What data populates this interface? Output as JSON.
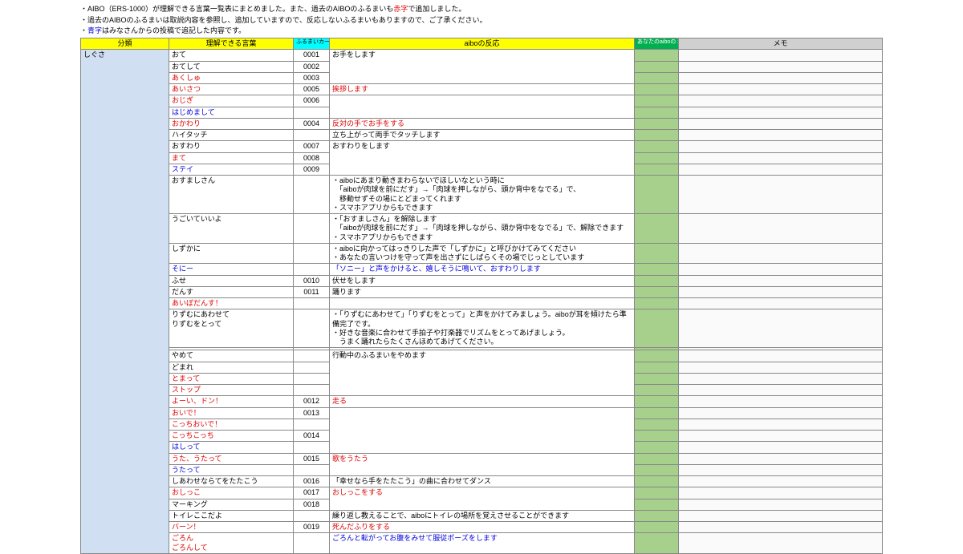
{
  "notes": {
    "line1a": "・AIBO（ERS-1000）が理解できる言葉一覧表にまとめました。また、過去のAIBOのふるまいも",
    "line1b": "赤字",
    "line1c": "で追加しました。",
    "line2": "・過去のAIBOのふるまいは取説内容を参照し、追加していますので、反応しないふるまいもありますので、ご了承ください。",
    "line3a": "・",
    "line3b": "青字",
    "line3c": "はみなさんからの投稿で追記した内容です。"
  },
  "headers": {
    "category": "分類",
    "word": "理解できる言葉",
    "card": "ふるまいカード\nNo",
    "reaction": "aiboの反応",
    "check": "あなたのaiboの\n理解度チェック",
    "memo": "メモ"
  },
  "category": "しぐさ",
  "rows": [
    {
      "word": "おて",
      "card": "0001",
      "react": "お手をします",
      "color": "",
      "rb": "bb-none"
    },
    {
      "word": "おてして",
      "card": "0002",
      "react": "",
      "color": "",
      "rt": "bt-none",
      "rb": "bb-none"
    },
    {
      "word": "あくしゅ",
      "card": "0003",
      "react": "",
      "color": "t-red",
      "rt": "bt-none",
      "rb": "bb-none"
    },
    {
      "word": "あいさつ",
      "card": "0005",
      "react": "挨拶します",
      "rcolor": "t-red",
      "color": "t-red"
    },
    {
      "word": "おじぎ",
      "card": "0006",
      "react": "",
      "color": "t-red",
      "rb": "bb-none"
    },
    {
      "word": "はじめまして",
      "card": "",
      "react": "",
      "color": "t-blue",
      "rt": "bt-none"
    },
    {
      "word": "おかわり",
      "card": "0004",
      "react": "反対の手でお手をする",
      "rcolor": "t-red",
      "color": "t-red"
    },
    {
      "word": "ハイタッチ",
      "card": "",
      "react": "立ち上がって両手でタッチします",
      "color": ""
    },
    {
      "word": "おすわり",
      "card": "0007",
      "react": "おすわりをします",
      "color": "",
      "rb": "bb-none"
    },
    {
      "word": "まて",
      "card": "0008",
      "react": "",
      "color": "t-red",
      "rt": "bt-none",
      "rb": "bb-none"
    },
    {
      "word": "ステイ",
      "card": "0009",
      "react": "",
      "color": "t-blue",
      "rt": "bt-none"
    },
    {
      "word": "おすましさん",
      "card": "",
      "react": "・aiboにあまり動きまわらないでほしいなという時に\n　「aiboが肉球を前にだす」→「肉球を押しながら、頭か背中をなでる」で、\n　移動せずその場にとどまってくれます\n・スマホアプリからもできます",
      "color": ""
    },
    {
      "word": "うごいていいよ",
      "card": "",
      "react": "・「おすましさん」を解除します\n　「aiboが肉球を前にだす」→「肉球を押しながら、頭か背中をなでる」で、解除できます\n・スマホアプリからもできます",
      "color": ""
    },
    {
      "word": "しずかに",
      "card": "",
      "react": "・aiboに向かってはっきりした声で「しずかに」と呼びかけてみてください\n・あなたの言いつけを守って声を出さずにしばらくその場でじっとしています",
      "color": ""
    },
    {
      "word": "そにー",
      "card": "",
      "react": "「ソニー」と声をかけると、嬉しそうに鳴いて、おすわりします",
      "rcolor": "t-blue",
      "color": "t-blue"
    },
    {
      "word": "ふせ",
      "card": "0010",
      "react": "伏せをします",
      "color": ""
    },
    {
      "word": "だんす",
      "card": "0011",
      "react": "踊ります",
      "color": ""
    },
    {
      "word": "あいぼだんす！",
      "card": "",
      "react": "",
      "color": "t-red"
    },
    {
      "word": "りずむにあわせて\nりずむをとって",
      "card": "",
      "react": "・「りずむにあわせて」「りずむをとって」と声をかけてみましょう。aiboが耳を傾けたら準備完了です。\n・好きな音楽に合わせて手拍子や打楽器でリズムをとってあげましょう。\n　うまく踊れたらたくさんほめてあげてください。",
      "color": ""
    },
    {
      "word": "",
      "card": "",
      "react": "",
      "color": ""
    },
    {
      "word": "やめて",
      "card": "",
      "react": "行動中のふるまいをやめます",
      "color": "",
      "rb": "bb-none"
    },
    {
      "word": "どまれ",
      "card": "",
      "react": "",
      "color": "",
      "rt": "bt-none",
      "rb": "bb-none"
    },
    {
      "word": "とまって",
      "card": "",
      "react": "",
      "color": "t-red",
      "rt": "bt-none",
      "rb": "bb-none"
    },
    {
      "word": "ストップ",
      "card": "",
      "react": "",
      "color": "t-red",
      "rt": "bt-none"
    },
    {
      "word": "よーい、ドン！",
      "card": "0012",
      "react": "走る",
      "rcolor": "t-red",
      "color": "t-red"
    },
    {
      "word": "おいで！",
      "card": "0013",
      "react": "",
      "color": "t-red",
      "rb": "bb-none"
    },
    {
      "word": "こっちおいで！",
      "card": "",
      "react": "",
      "color": "t-red",
      "rt": "bt-none",
      "rb": "bb-none"
    },
    {
      "word": "こっちこっち",
      "card": "0014",
      "react": "",
      "color": "t-red",
      "rt": "bt-none",
      "rb": "bb-none"
    },
    {
      "word": "はしって",
      "card": "",
      "react": "",
      "color": "t-blue",
      "rt": "bt-none"
    },
    {
      "word": "うた、うたって",
      "card": "0015",
      "react": "歌をうたう",
      "rcolor": "t-red",
      "color": "t-red",
      "rb": "bb-none"
    },
    {
      "word": "うたって",
      "card": "",
      "react": "",
      "color": "t-blue",
      "rt": "bt-none"
    },
    {
      "word": "しあわせならてをたたこう",
      "card": "0016",
      "react": "「幸せなら手をたたこう」の曲に合わせてダンス",
      "color": ""
    },
    {
      "word": "おしっこ",
      "card": "0017",
      "react": "おしっこをする",
      "rcolor": "t-red",
      "color": "t-red",
      "rb": "bb-none"
    },
    {
      "word": "マーキング",
      "card": "0018",
      "react": "",
      "color": "",
      "rt": "bt-none"
    },
    {
      "word": "トイレここだよ",
      "card": "",
      "react": "繰り返し教えることで、aiboにトイレの場所を覚えさせることができます",
      "color": ""
    },
    {
      "word": "バーン！",
      "card": "0019",
      "react": "死んだふりをする",
      "rcolor": "t-red",
      "color": "t-red"
    },
    {
      "word": "ごろん\nごろんして",
      "card": "",
      "react": "ごろんと転がってお腹をみせて服従ポーズをします",
      "rcolor": "t-blue",
      "color": "t-red"
    }
  ]
}
